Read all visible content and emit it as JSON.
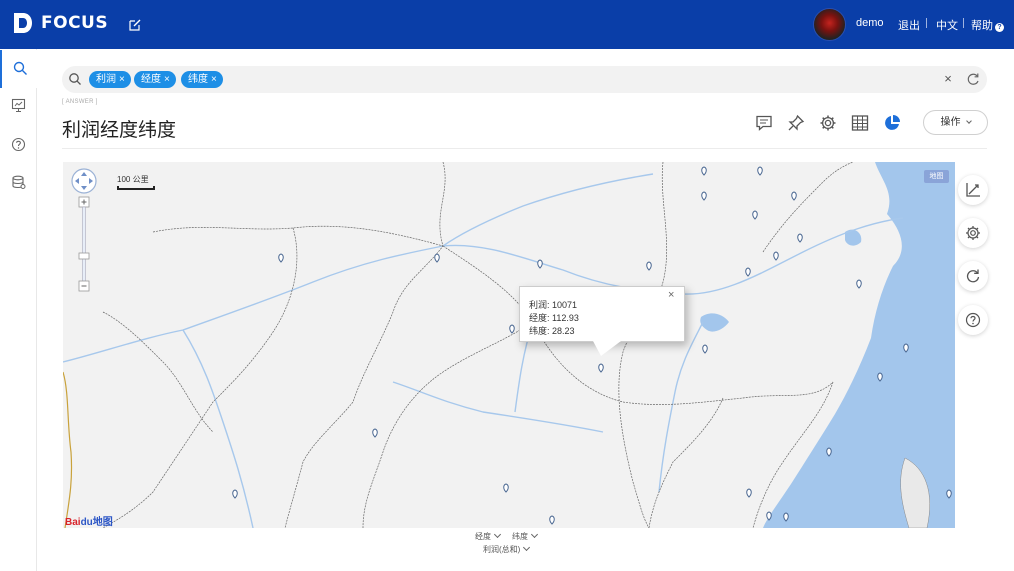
{
  "app": {
    "logo_text": "FOCUS",
    "user_name": "demo",
    "logout": "退出",
    "language": "中文",
    "help": "帮助",
    "help_badge": "?"
  },
  "search": {
    "chips": [
      {
        "label": "利润",
        "x": "×"
      },
      {
        "label": "经度",
        "x": "×"
      },
      {
        "label": "纬度",
        "x": "×"
      }
    ],
    "clear": "×"
  },
  "answer": {
    "tag": "[ ANSWER ]",
    "title": "利润经度纬度",
    "ops_label": "操作"
  },
  "map": {
    "badge": "地图",
    "scale": "100 公里",
    "baidu_1": "Bai",
    "baidu_2": "du",
    "baidu_3": "地图",
    "tooltip": {
      "line1": "利润: 10071",
      "line2": "经度: 112.93",
      "line3": "纬度: 28.23",
      "close": "×"
    }
  },
  "axes": {
    "x_field": "经度",
    "y_field": "纬度",
    "value_field": "利润(总和)"
  },
  "colors": {
    "brand": "#0a3ea8",
    "accent": "#1e8fe6",
    "water": "#a3c6ec"
  }
}
